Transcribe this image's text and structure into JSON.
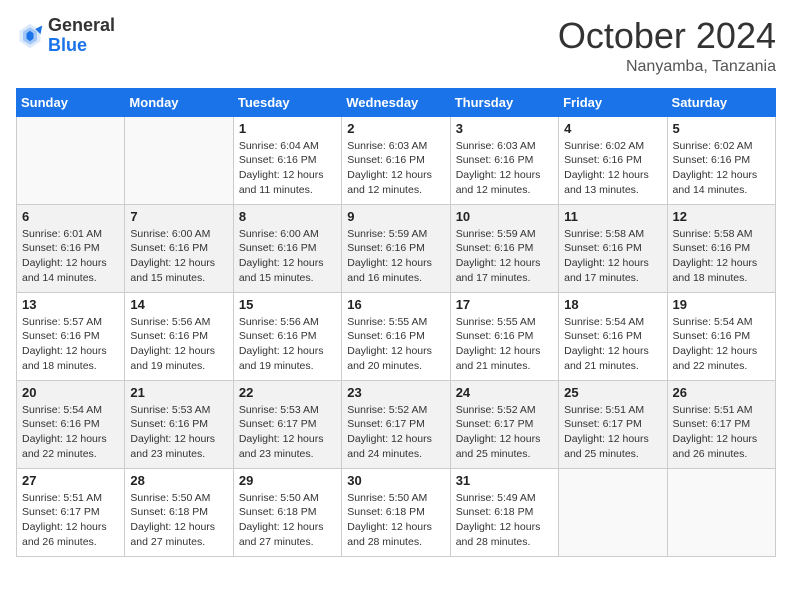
{
  "header": {
    "logo_general": "General",
    "logo_blue": "Blue",
    "month_title": "October 2024",
    "location": "Nanyamba, Tanzania"
  },
  "days_of_week": [
    "Sunday",
    "Monday",
    "Tuesday",
    "Wednesday",
    "Thursday",
    "Friday",
    "Saturday"
  ],
  "weeks": [
    [
      {
        "day": "",
        "empty": true
      },
      {
        "day": "",
        "empty": true
      },
      {
        "day": "1",
        "sunrise": "Sunrise: 6:04 AM",
        "sunset": "Sunset: 6:16 PM",
        "daylight": "Daylight: 12 hours and 11 minutes."
      },
      {
        "day": "2",
        "sunrise": "Sunrise: 6:03 AM",
        "sunset": "Sunset: 6:16 PM",
        "daylight": "Daylight: 12 hours and 12 minutes."
      },
      {
        "day": "3",
        "sunrise": "Sunrise: 6:03 AM",
        "sunset": "Sunset: 6:16 PM",
        "daylight": "Daylight: 12 hours and 12 minutes."
      },
      {
        "day": "4",
        "sunrise": "Sunrise: 6:02 AM",
        "sunset": "Sunset: 6:16 PM",
        "daylight": "Daylight: 12 hours and 13 minutes."
      },
      {
        "day": "5",
        "sunrise": "Sunrise: 6:02 AM",
        "sunset": "Sunset: 6:16 PM",
        "daylight": "Daylight: 12 hours and 14 minutes."
      }
    ],
    [
      {
        "day": "6",
        "sunrise": "Sunrise: 6:01 AM",
        "sunset": "Sunset: 6:16 PM",
        "daylight": "Daylight: 12 hours and 14 minutes."
      },
      {
        "day": "7",
        "sunrise": "Sunrise: 6:00 AM",
        "sunset": "Sunset: 6:16 PM",
        "daylight": "Daylight: 12 hours and 15 minutes."
      },
      {
        "day": "8",
        "sunrise": "Sunrise: 6:00 AM",
        "sunset": "Sunset: 6:16 PM",
        "daylight": "Daylight: 12 hours and 15 minutes."
      },
      {
        "day": "9",
        "sunrise": "Sunrise: 5:59 AM",
        "sunset": "Sunset: 6:16 PM",
        "daylight": "Daylight: 12 hours and 16 minutes."
      },
      {
        "day": "10",
        "sunrise": "Sunrise: 5:59 AM",
        "sunset": "Sunset: 6:16 PM",
        "daylight": "Daylight: 12 hours and 17 minutes."
      },
      {
        "day": "11",
        "sunrise": "Sunrise: 5:58 AM",
        "sunset": "Sunset: 6:16 PM",
        "daylight": "Daylight: 12 hours and 17 minutes."
      },
      {
        "day": "12",
        "sunrise": "Sunrise: 5:58 AM",
        "sunset": "Sunset: 6:16 PM",
        "daylight": "Daylight: 12 hours and 18 minutes."
      }
    ],
    [
      {
        "day": "13",
        "sunrise": "Sunrise: 5:57 AM",
        "sunset": "Sunset: 6:16 PM",
        "daylight": "Daylight: 12 hours and 18 minutes."
      },
      {
        "day": "14",
        "sunrise": "Sunrise: 5:56 AM",
        "sunset": "Sunset: 6:16 PM",
        "daylight": "Daylight: 12 hours and 19 minutes."
      },
      {
        "day": "15",
        "sunrise": "Sunrise: 5:56 AM",
        "sunset": "Sunset: 6:16 PM",
        "daylight": "Daylight: 12 hours and 19 minutes."
      },
      {
        "day": "16",
        "sunrise": "Sunrise: 5:55 AM",
        "sunset": "Sunset: 6:16 PM",
        "daylight": "Daylight: 12 hours and 20 minutes."
      },
      {
        "day": "17",
        "sunrise": "Sunrise: 5:55 AM",
        "sunset": "Sunset: 6:16 PM",
        "daylight": "Daylight: 12 hours and 21 minutes."
      },
      {
        "day": "18",
        "sunrise": "Sunrise: 5:54 AM",
        "sunset": "Sunset: 6:16 PM",
        "daylight": "Daylight: 12 hours and 21 minutes."
      },
      {
        "day": "19",
        "sunrise": "Sunrise: 5:54 AM",
        "sunset": "Sunset: 6:16 PM",
        "daylight": "Daylight: 12 hours and 22 minutes."
      }
    ],
    [
      {
        "day": "20",
        "sunrise": "Sunrise: 5:54 AM",
        "sunset": "Sunset: 6:16 PM",
        "daylight": "Daylight: 12 hours and 22 minutes."
      },
      {
        "day": "21",
        "sunrise": "Sunrise: 5:53 AM",
        "sunset": "Sunset: 6:16 PM",
        "daylight": "Daylight: 12 hours and 23 minutes."
      },
      {
        "day": "22",
        "sunrise": "Sunrise: 5:53 AM",
        "sunset": "Sunset: 6:17 PM",
        "daylight": "Daylight: 12 hours and 23 minutes."
      },
      {
        "day": "23",
        "sunrise": "Sunrise: 5:52 AM",
        "sunset": "Sunset: 6:17 PM",
        "daylight": "Daylight: 12 hours and 24 minutes."
      },
      {
        "day": "24",
        "sunrise": "Sunrise: 5:52 AM",
        "sunset": "Sunset: 6:17 PM",
        "daylight": "Daylight: 12 hours and 25 minutes."
      },
      {
        "day": "25",
        "sunrise": "Sunrise: 5:51 AM",
        "sunset": "Sunset: 6:17 PM",
        "daylight": "Daylight: 12 hours and 25 minutes."
      },
      {
        "day": "26",
        "sunrise": "Sunrise: 5:51 AM",
        "sunset": "Sunset: 6:17 PM",
        "daylight": "Daylight: 12 hours and 26 minutes."
      }
    ],
    [
      {
        "day": "27",
        "sunrise": "Sunrise: 5:51 AM",
        "sunset": "Sunset: 6:17 PM",
        "daylight": "Daylight: 12 hours and 26 minutes."
      },
      {
        "day": "28",
        "sunrise": "Sunrise: 5:50 AM",
        "sunset": "Sunset: 6:18 PM",
        "daylight": "Daylight: 12 hours and 27 minutes."
      },
      {
        "day": "29",
        "sunrise": "Sunrise: 5:50 AM",
        "sunset": "Sunset: 6:18 PM",
        "daylight": "Daylight: 12 hours and 27 minutes."
      },
      {
        "day": "30",
        "sunrise": "Sunrise: 5:50 AM",
        "sunset": "Sunset: 6:18 PM",
        "daylight": "Daylight: 12 hours and 28 minutes."
      },
      {
        "day": "31",
        "sunrise": "Sunrise: 5:49 AM",
        "sunset": "Sunset: 6:18 PM",
        "daylight": "Daylight: 12 hours and 28 minutes."
      },
      {
        "day": "",
        "empty": true
      },
      {
        "day": "",
        "empty": true
      }
    ]
  ]
}
